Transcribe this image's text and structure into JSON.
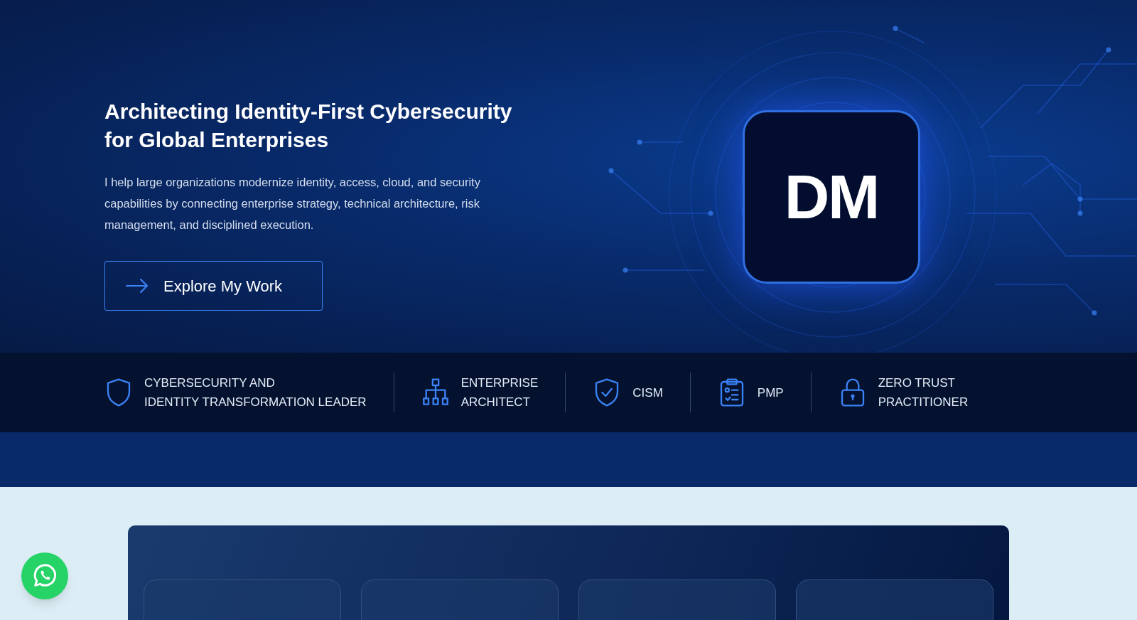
{
  "hero": {
    "title_lines": [
      "Architecting Identity-First Cybersecurity",
      "for Global Enterprises"
    ],
    "description": "I help large organizations modernize identity, access, cloud, and security capabilities by connecting enterprise strategy, technical architecture, risk management, and disciplined execution.",
    "cta": {
      "label": "Explore My Work"
    },
    "monogram": "DM"
  },
  "credentials": [
    {
      "kind": "shield",
      "lines": [
        "CYBERSECURITY AND",
        "IDENTITY TRANSFORMATION LEADER"
      ]
    },
    {
      "kind": "hierarchy",
      "lines": [
        "ENTERPRISE",
        "ARCHITECT"
      ]
    },
    {
      "kind": "shield-check",
      "lines": [
        "CISM"
      ]
    },
    {
      "kind": "clipboard",
      "lines": [
        "PMP"
      ]
    },
    {
      "kind": "lock",
      "lines": [
        "ZERO TRUST",
        "PRACTITIONER"
      ]
    }
  ],
  "stats": {
    "cards": [
      {
        "kind": "stat"
      },
      {
        "kind": "stat"
      },
      {
        "kind": "stat"
      },
      {
        "kind": "stat"
      }
    ]
  },
  "chat_button": {
    "kind": "whatsapp"
  }
}
